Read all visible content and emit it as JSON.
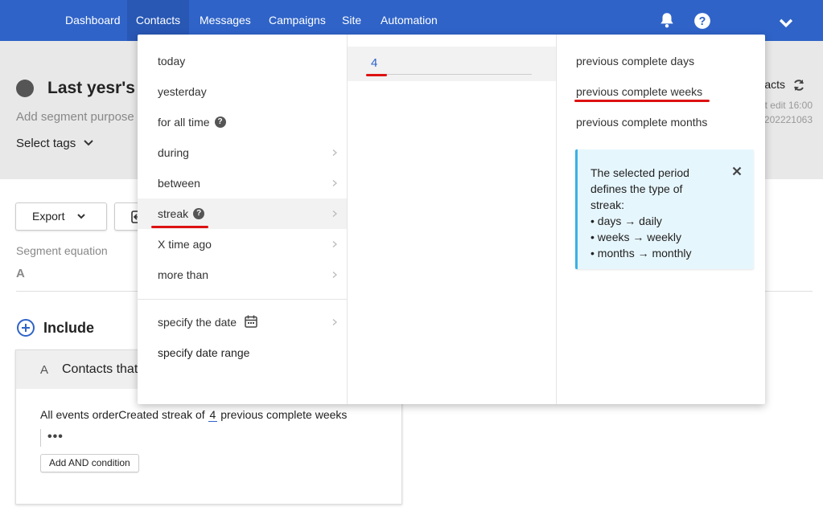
{
  "nav": {
    "items": [
      "Dashboard",
      "Contacts",
      "Messages",
      "Campaigns",
      "Site",
      "Automation"
    ],
    "active": "Contacts"
  },
  "header": {
    "title": "Last yesr's b",
    "purpose_placeholder": "Add segment purpose",
    "select_tags": "Select tags",
    "right_text": "acts",
    "right_edit": "t edit 16:00",
    "right_id": "202221063"
  },
  "body": {
    "export_label": "Export",
    "segment_equation_label": "Segment equation",
    "segment_equation_value": "A",
    "include_label": "Include",
    "condition": {
      "letter": "A",
      "title": "Contacts that",
      "line_prefix": "All events orderCreated  streak of ",
      "line_number": "4",
      "line_suffix": " previous complete weeks",
      "dots": "•••",
      "add_and_label": "Add AND condition"
    }
  },
  "dropdown": {
    "options": [
      {
        "label": "today",
        "has_help": false,
        "has_chevron": false,
        "selected": false
      },
      {
        "label": "yesterday",
        "has_help": false,
        "has_chevron": false,
        "selected": false
      },
      {
        "label": "for all time",
        "has_help": true,
        "has_chevron": false,
        "selected": false
      },
      {
        "label": "during",
        "has_help": false,
        "has_chevron": true,
        "selected": false
      },
      {
        "label": "between",
        "has_help": false,
        "has_chevron": true,
        "selected": false
      },
      {
        "label": "streak",
        "has_help": true,
        "has_chevron": true,
        "selected": true
      },
      {
        "label": "X time ago",
        "has_help": false,
        "has_chevron": true,
        "selected": false
      },
      {
        "label": "more than",
        "has_help": false,
        "has_chevron": true,
        "selected": false
      }
    ],
    "specify_date": "specify the date",
    "specify_date_range": "specify date range",
    "number_value": "4",
    "periods": [
      "previous complete days",
      "previous complete weeks",
      "previous complete months"
    ],
    "selected_period": "previous complete weeks",
    "info": {
      "lines": [
        "The selected period",
        "defines the type of",
        "streak:",
        "• days → daily",
        "• weeks → weekly",
        "• months → monthly"
      ]
    }
  },
  "colors": {
    "nav_bg": "#2f63c8",
    "annotation_red": "#dd1111",
    "info_bg": "#e6f6fd",
    "info_border": "#3cb0e6"
  }
}
